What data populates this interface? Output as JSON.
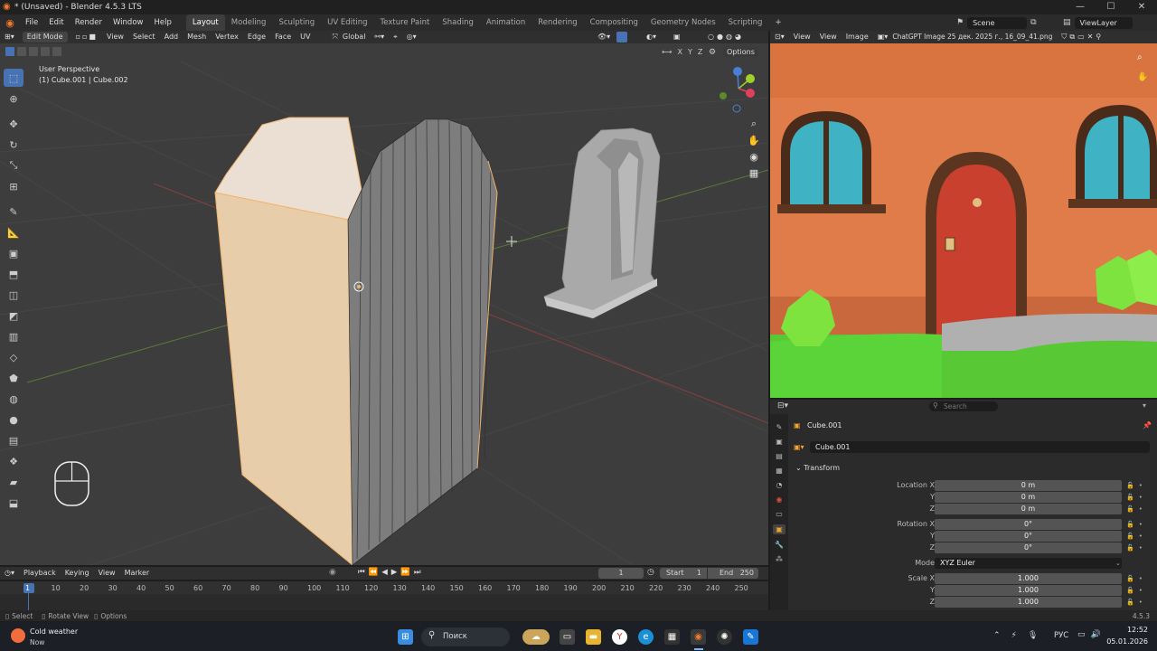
{
  "window": {
    "title": "* (Unsaved) - Blender 4.5.3 LTS",
    "buttons": [
      "—",
      "☐",
      "✕"
    ]
  },
  "menu": {
    "items": [
      "File",
      "Edit",
      "Render",
      "Window",
      "Help"
    ]
  },
  "workspaces": [
    "Layout",
    "Modeling",
    "Sculpting",
    "UV Editing",
    "Texture Paint",
    "Shading",
    "Animation",
    "Rendering",
    "Compositing",
    "Geometry Nodes",
    "Scripting"
  ],
  "active_workspace": "Layout",
  "scene": {
    "scene_name": "Scene",
    "view_layer": "ViewLayer"
  },
  "viewport_header": {
    "mode": "Edit Mode",
    "menus": [
      "View",
      "Select",
      "Add",
      "Mesh",
      "Vertex",
      "Edge",
      "Face",
      "UV"
    ],
    "orientation": "Global",
    "options": "Options",
    "axes": [
      "X",
      "Y",
      "Z"
    ]
  },
  "viewport": {
    "perspective": "User Perspective",
    "object_info": "(1) Cube.001 | Cube.002"
  },
  "image_editor": {
    "menus": [
      "View",
      "View",
      "Image"
    ],
    "image_name": "ChatGPT Image 25 дек. 2025 г., 16_09_41.png"
  },
  "properties": {
    "search_placeholder": "Search",
    "object_name": "Cube.001",
    "object_data": "Cube.001",
    "panel": "Transform",
    "location": {
      "label": "Location X",
      "x": "0 m",
      "y": "0 m",
      "z": "0 m"
    },
    "rotation": {
      "label": "Rotation X",
      "x": "0°",
      "y": "0°",
      "z": "0°"
    },
    "mode_label": "Mode",
    "mode_value": "XYZ Euler",
    "scale": {
      "label": "Scale X",
      "x": "1.000",
      "y": "1.000",
      "z": "1.000"
    },
    "axis_y": "Y",
    "axis_z": "Z"
  },
  "timeline": {
    "menus": [
      "Playback",
      "Keying",
      "View",
      "Marker"
    ],
    "current_frame": "1",
    "start_label": "Start",
    "start": "1",
    "end_label": "End",
    "end": "250",
    "ruler": [
      "1",
      "10",
      "20",
      "30",
      "40",
      "50",
      "60",
      "70",
      "80",
      "90",
      "100",
      "110",
      "120",
      "130",
      "140",
      "150",
      "160",
      "170",
      "180",
      "190",
      "200",
      "210",
      "220",
      "230",
      "240",
      "250"
    ]
  },
  "status": {
    "items": [
      "Select",
      "Rotate View",
      "Options"
    ],
    "version": "4.5.3"
  },
  "taskbar": {
    "weather_title": "Cold weather",
    "weather_sub": "Now",
    "search_text": "Поиск",
    "lang": "РУС",
    "time": "12:52",
    "date": "05.01.2026"
  },
  "colors": {
    "accent": "#4772b3",
    "selected_face": "#e8c9a0",
    "wall": "#e07c4a",
    "door": "#c9412e",
    "grass": "#5bd43a"
  }
}
